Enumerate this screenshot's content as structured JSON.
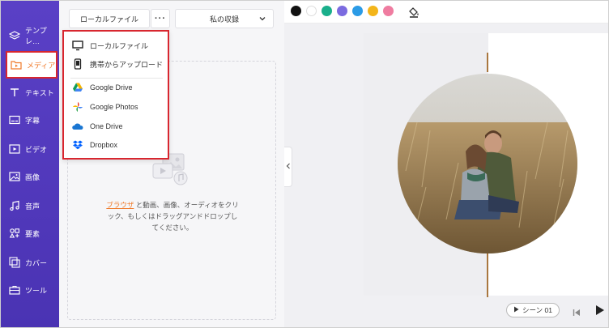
{
  "sidebar": {
    "items": [
      {
        "label": "テンプレ…",
        "icon": "layers-icon"
      },
      {
        "label": "メディア",
        "icon": "media-folder-icon"
      },
      {
        "label": "テキスト",
        "icon": "text-icon"
      },
      {
        "label": "字幕",
        "icon": "subtitle-icon"
      },
      {
        "label": "ビデオ",
        "icon": "video-icon"
      },
      {
        "label": "画像",
        "icon": "image-icon"
      },
      {
        "label": "音声",
        "icon": "music-icon"
      },
      {
        "label": "要素",
        "icon": "elements-icon"
      },
      {
        "label": "カバー",
        "icon": "cover-icon"
      },
      {
        "label": "ツール",
        "icon": "toolbox-icon"
      }
    ]
  },
  "panel": {
    "local_file_button": "ローカルファイル",
    "more_button": "···",
    "collection_select": "私の収録",
    "dropzone": {
      "link": "ブラウザ",
      "text_after_link": " と動画、画像、オーディオをクリ",
      "line2": "ック、もしくはドラッグアンドドロップし",
      "line3": "てください。"
    }
  },
  "menu": {
    "items": [
      {
        "label": "ローカルファイル",
        "icon": "monitor-icon"
      },
      {
        "label": "携帯からアップロード",
        "icon": "phone-icon"
      },
      {
        "label": "Google Drive",
        "icon": "google-drive-icon"
      },
      {
        "label": "Google Photos",
        "icon": "google-photos-icon"
      },
      {
        "label": "One Drive",
        "icon": "onedrive-icon"
      },
      {
        "label": "Dropbox",
        "icon": "dropbox-icon"
      }
    ]
  },
  "toolbar": {
    "swatches": [
      "#111111",
      "#ffffff",
      "#1aaf8b",
      "#7b6be0",
      "#2b9be6",
      "#f3b51a",
      "#ef7ca0"
    ]
  },
  "playback": {
    "scene_label": "シーン 01"
  },
  "colors": {
    "sidebar": "#5a40c6",
    "accent": "#f07a2a",
    "highlight_border": "#d8262f"
  }
}
